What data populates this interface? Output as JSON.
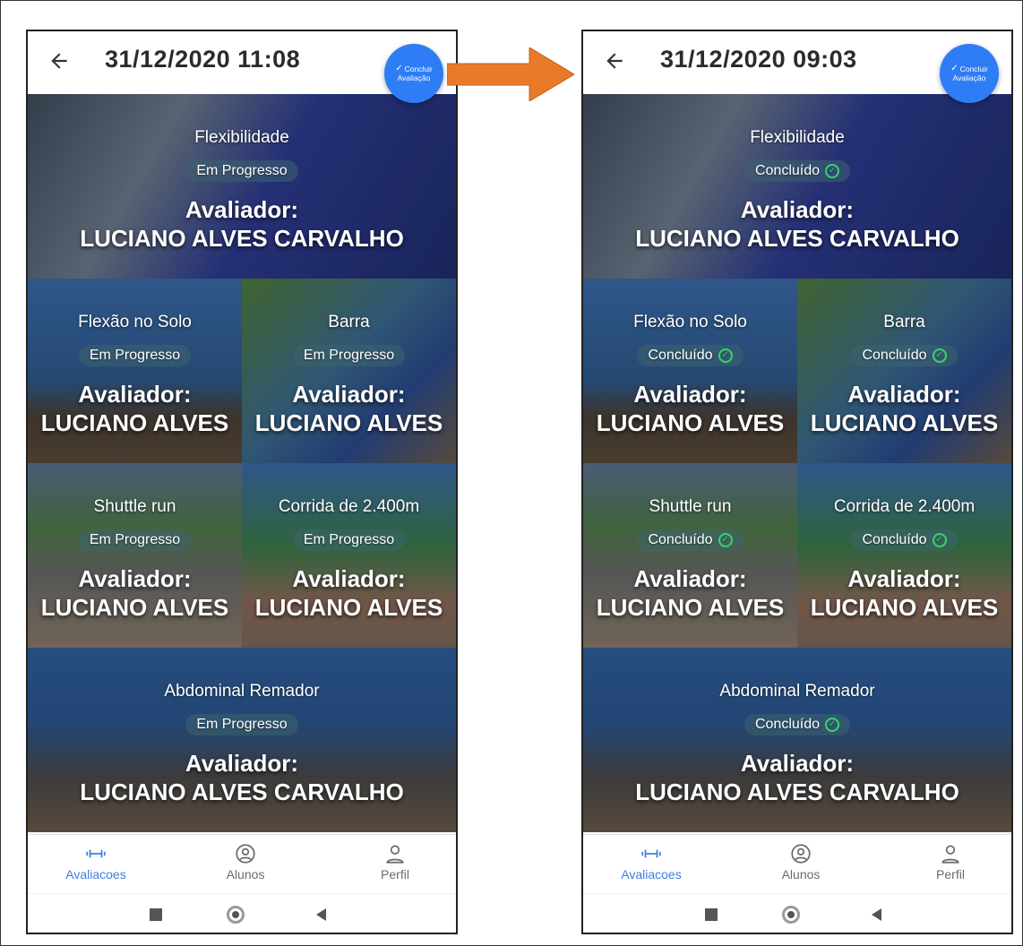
{
  "screens": [
    {
      "title": "31/12/2020 11:08",
      "fab": {
        "line1": "Concluir",
        "line2": "Avaliação"
      },
      "cards": [
        {
          "name": "Flexibilidade",
          "status": "Em Progresso",
          "done": false,
          "evaluator_label": "Avaliador:",
          "evaluator": "LUCIANO ALVES CARVALHO"
        },
        {
          "name": "Flexão no Solo",
          "status": "Em Progresso",
          "done": false,
          "evaluator_label": "Avaliador:",
          "evaluator": "LUCIANO ALVES"
        },
        {
          "name": "Barra",
          "status": "Em Progresso",
          "done": false,
          "evaluator_label": "Avaliador:",
          "evaluator": "LUCIANO ALVES"
        },
        {
          "name": "Shuttle run",
          "status": "Em Progresso",
          "done": false,
          "evaluator_label": "Avaliador:",
          "evaluator": "LUCIANO ALVES"
        },
        {
          "name": "Corrida de 2.400m",
          "status": "Em Progresso",
          "done": false,
          "evaluator_label": "Avaliador:",
          "evaluator": "LUCIANO ALVES"
        },
        {
          "name": "Abdominal Remador",
          "status": "Em Progresso",
          "done": false,
          "evaluator_label": "Avaliador:",
          "evaluator": "LUCIANO ALVES CARVALHO"
        }
      ],
      "nav": [
        "Avaliacoes",
        "Alunos",
        "Perfil"
      ]
    },
    {
      "title": "31/12/2020 09:03",
      "fab": {
        "line1": "Concluir",
        "line2": "Avaliação"
      },
      "cards": [
        {
          "name": "Flexibilidade",
          "status": "Concluído",
          "done": true,
          "evaluator_label": "Avaliador:",
          "evaluator": "LUCIANO ALVES CARVALHO"
        },
        {
          "name": "Flexão no Solo",
          "status": "Concluído",
          "done": true,
          "evaluator_label": "Avaliador:",
          "evaluator": "LUCIANO ALVES"
        },
        {
          "name": "Barra",
          "status": "Concluído",
          "done": true,
          "evaluator_label": "Avaliador:",
          "evaluator": "LUCIANO ALVES"
        },
        {
          "name": "Shuttle run",
          "status": "Concluído",
          "done": true,
          "evaluator_label": "Avaliador:",
          "evaluator": "LUCIANO ALVES"
        },
        {
          "name": "Corrida de 2.400m",
          "status": "Concluído",
          "done": true,
          "evaluator_label": "Avaliador:",
          "evaluator": "LUCIANO ALVES"
        },
        {
          "name": "Abdominal Remador",
          "status": "Concluído",
          "done": true,
          "evaluator_label": "Avaliador:",
          "evaluator": "LUCIANO ALVES CARVALHO"
        }
      ],
      "nav": [
        "Avaliacoes",
        "Alunos",
        "Perfil"
      ]
    }
  ],
  "colors": {
    "accent": "#2f7df6",
    "nav_active": "#3d7fe0",
    "check": "#39d36b",
    "arrow": "#e87a2a"
  },
  "icons": {
    "back": "arrow-left-icon",
    "fab": "check-icon",
    "nav": [
      "dumbbell-icon",
      "account-circle-icon",
      "person-icon"
    ]
  }
}
